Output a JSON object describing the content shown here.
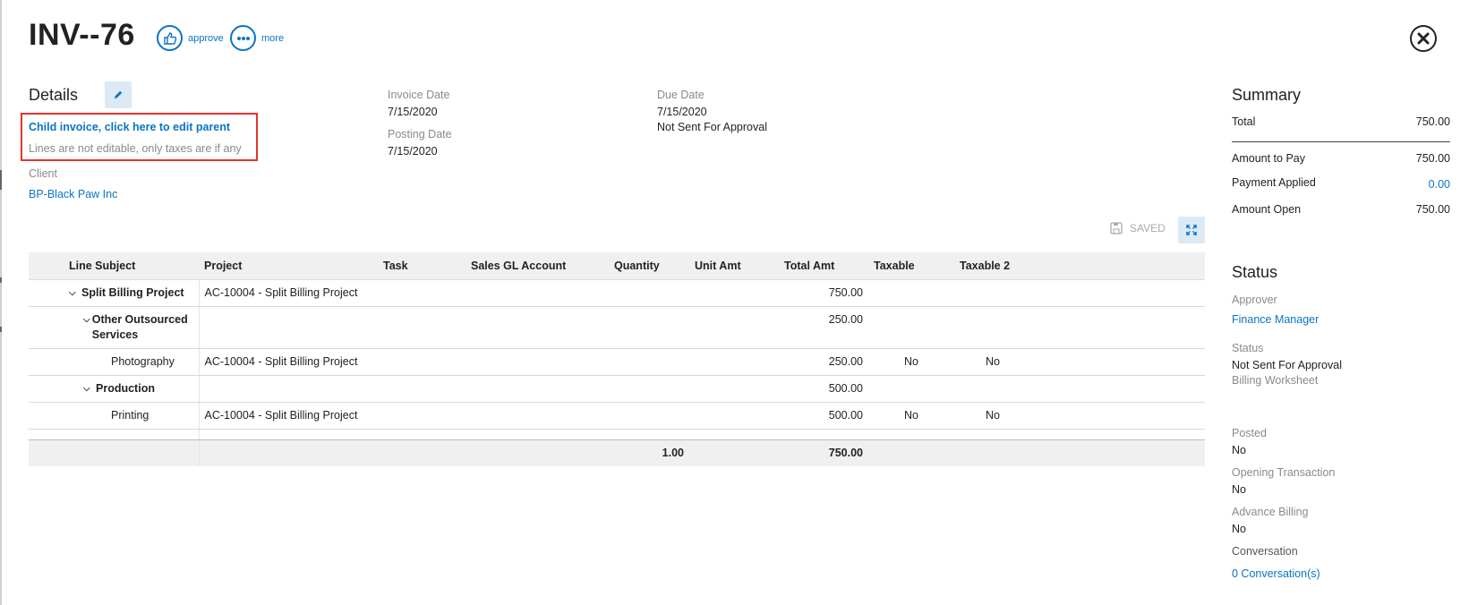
{
  "header": {
    "title": "INV--76",
    "approve_label": "approve",
    "more_label": "more"
  },
  "details": {
    "heading": "Details",
    "child_invoice_link": "Child invoice, click here to edit parent",
    "lines_note": "Lines are not editable, only taxes are if any",
    "client_label": "Client",
    "client_value": "BP-Black Paw Inc",
    "invoice_date_label": "Invoice Date",
    "invoice_date": "7/15/2020",
    "posting_date_label": "Posting Date",
    "posting_date": "7/15/2020",
    "due_date_label": "Due Date",
    "due_date": "7/15/2020",
    "approval_status": "Not Sent For Approval"
  },
  "toolbar": {
    "saved_label": "SAVED"
  },
  "table": {
    "columns": [
      "Line Subject",
      "Project",
      "Task",
      "Sales GL Account",
      "Quantity",
      "Unit Amt",
      "Total Amt",
      "Taxable",
      "Taxable 2"
    ],
    "rows": [
      {
        "subject": "Split Billing Project",
        "project": "AC-10004 - Split Billing Project",
        "total": "750.00"
      },
      {
        "subject": "Other Outsourced Services",
        "project": "",
        "total": "250.00"
      },
      {
        "subject": "Photography",
        "project": "AC-10004 - Split Billing Project",
        "total": "250.00",
        "taxable": "No",
        "taxable2": "No"
      },
      {
        "subject": "Production",
        "project": "",
        "total": "500.00"
      },
      {
        "subject": "Printing",
        "project": "AC-10004 - Split Billing Project",
        "total": "500.00",
        "taxable": "No",
        "taxable2": "No"
      }
    ],
    "totals": {
      "quantity": "1.00",
      "total": "750.00"
    }
  },
  "summary": {
    "heading": "Summary",
    "total_label": "Total",
    "total_value": "750.00",
    "amount_to_pay_label": "Amount to Pay",
    "amount_to_pay_value": "750.00",
    "payment_applied_label": "Payment Applied",
    "payment_applied_value": "0.00",
    "amount_open_label": "Amount Open",
    "amount_open_value": "750.00"
  },
  "status": {
    "heading": "Status",
    "approver_label": "Approver",
    "approver_value": "Finance Manager",
    "status_label": "Status",
    "status_value": "Not Sent For Approval",
    "status_sub": "Billing Worksheet",
    "posted_label": "Posted",
    "posted_value": "No",
    "opening_label": "Opening Transaction",
    "opening_value": "No",
    "advance_label": "Advance Billing",
    "advance_value": "No",
    "conversation_label": "Conversation",
    "conversation_value": "0 Conversation(s)"
  },
  "colors": {
    "accent": "#0a75c2",
    "highlight": "#e3342f"
  }
}
